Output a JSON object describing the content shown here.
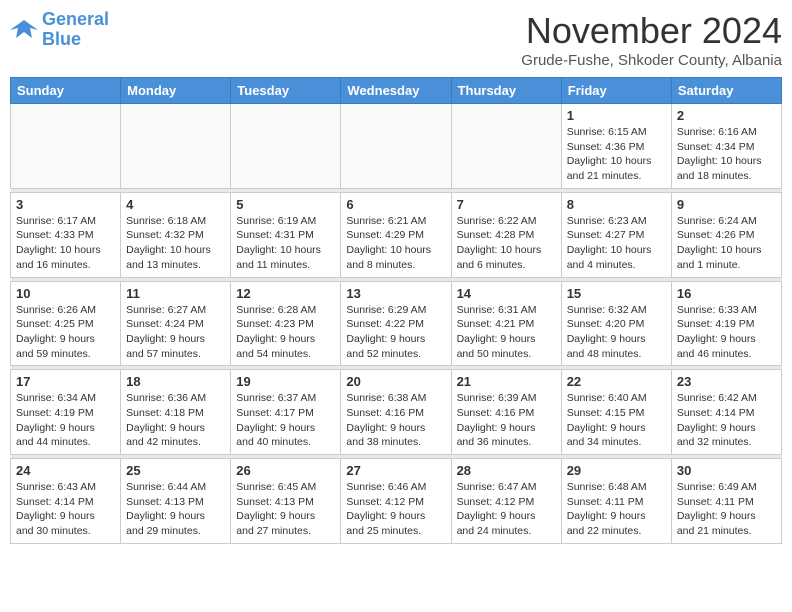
{
  "header": {
    "logo_line1": "General",
    "logo_line2": "Blue",
    "month_title": "November 2024",
    "subtitle": "Grude-Fushe, Shkoder County, Albania"
  },
  "weekdays": [
    "Sunday",
    "Monday",
    "Tuesday",
    "Wednesday",
    "Thursday",
    "Friday",
    "Saturday"
  ],
  "weeks": [
    [
      {
        "day": "",
        "info": ""
      },
      {
        "day": "",
        "info": ""
      },
      {
        "day": "",
        "info": ""
      },
      {
        "day": "",
        "info": ""
      },
      {
        "day": "",
        "info": ""
      },
      {
        "day": "1",
        "info": "Sunrise: 6:15 AM\nSunset: 4:36 PM\nDaylight: 10 hours and 21 minutes."
      },
      {
        "day": "2",
        "info": "Sunrise: 6:16 AM\nSunset: 4:34 PM\nDaylight: 10 hours and 18 minutes."
      }
    ],
    [
      {
        "day": "3",
        "info": "Sunrise: 6:17 AM\nSunset: 4:33 PM\nDaylight: 10 hours and 16 minutes."
      },
      {
        "day": "4",
        "info": "Sunrise: 6:18 AM\nSunset: 4:32 PM\nDaylight: 10 hours and 13 minutes."
      },
      {
        "day": "5",
        "info": "Sunrise: 6:19 AM\nSunset: 4:31 PM\nDaylight: 10 hours and 11 minutes."
      },
      {
        "day": "6",
        "info": "Sunrise: 6:21 AM\nSunset: 4:29 PM\nDaylight: 10 hours and 8 minutes."
      },
      {
        "day": "7",
        "info": "Sunrise: 6:22 AM\nSunset: 4:28 PM\nDaylight: 10 hours and 6 minutes."
      },
      {
        "day": "8",
        "info": "Sunrise: 6:23 AM\nSunset: 4:27 PM\nDaylight: 10 hours and 4 minutes."
      },
      {
        "day": "9",
        "info": "Sunrise: 6:24 AM\nSunset: 4:26 PM\nDaylight: 10 hours and 1 minute."
      }
    ],
    [
      {
        "day": "10",
        "info": "Sunrise: 6:26 AM\nSunset: 4:25 PM\nDaylight: 9 hours and 59 minutes."
      },
      {
        "day": "11",
        "info": "Sunrise: 6:27 AM\nSunset: 4:24 PM\nDaylight: 9 hours and 57 minutes."
      },
      {
        "day": "12",
        "info": "Sunrise: 6:28 AM\nSunset: 4:23 PM\nDaylight: 9 hours and 54 minutes."
      },
      {
        "day": "13",
        "info": "Sunrise: 6:29 AM\nSunset: 4:22 PM\nDaylight: 9 hours and 52 minutes."
      },
      {
        "day": "14",
        "info": "Sunrise: 6:31 AM\nSunset: 4:21 PM\nDaylight: 9 hours and 50 minutes."
      },
      {
        "day": "15",
        "info": "Sunrise: 6:32 AM\nSunset: 4:20 PM\nDaylight: 9 hours and 48 minutes."
      },
      {
        "day": "16",
        "info": "Sunrise: 6:33 AM\nSunset: 4:19 PM\nDaylight: 9 hours and 46 minutes."
      }
    ],
    [
      {
        "day": "17",
        "info": "Sunrise: 6:34 AM\nSunset: 4:19 PM\nDaylight: 9 hours and 44 minutes."
      },
      {
        "day": "18",
        "info": "Sunrise: 6:36 AM\nSunset: 4:18 PM\nDaylight: 9 hours and 42 minutes."
      },
      {
        "day": "19",
        "info": "Sunrise: 6:37 AM\nSunset: 4:17 PM\nDaylight: 9 hours and 40 minutes."
      },
      {
        "day": "20",
        "info": "Sunrise: 6:38 AM\nSunset: 4:16 PM\nDaylight: 9 hours and 38 minutes."
      },
      {
        "day": "21",
        "info": "Sunrise: 6:39 AM\nSunset: 4:16 PM\nDaylight: 9 hours and 36 minutes."
      },
      {
        "day": "22",
        "info": "Sunrise: 6:40 AM\nSunset: 4:15 PM\nDaylight: 9 hours and 34 minutes."
      },
      {
        "day": "23",
        "info": "Sunrise: 6:42 AM\nSunset: 4:14 PM\nDaylight: 9 hours and 32 minutes."
      }
    ],
    [
      {
        "day": "24",
        "info": "Sunrise: 6:43 AM\nSunset: 4:14 PM\nDaylight: 9 hours and 30 minutes."
      },
      {
        "day": "25",
        "info": "Sunrise: 6:44 AM\nSunset: 4:13 PM\nDaylight: 9 hours and 29 minutes."
      },
      {
        "day": "26",
        "info": "Sunrise: 6:45 AM\nSunset: 4:13 PM\nDaylight: 9 hours and 27 minutes."
      },
      {
        "day": "27",
        "info": "Sunrise: 6:46 AM\nSunset: 4:12 PM\nDaylight: 9 hours and 25 minutes."
      },
      {
        "day": "28",
        "info": "Sunrise: 6:47 AM\nSunset: 4:12 PM\nDaylight: 9 hours and 24 minutes."
      },
      {
        "day": "29",
        "info": "Sunrise: 6:48 AM\nSunset: 4:11 PM\nDaylight: 9 hours and 22 minutes."
      },
      {
        "day": "30",
        "info": "Sunrise: 6:49 AM\nSunset: 4:11 PM\nDaylight: 9 hours and 21 minutes."
      }
    ]
  ]
}
